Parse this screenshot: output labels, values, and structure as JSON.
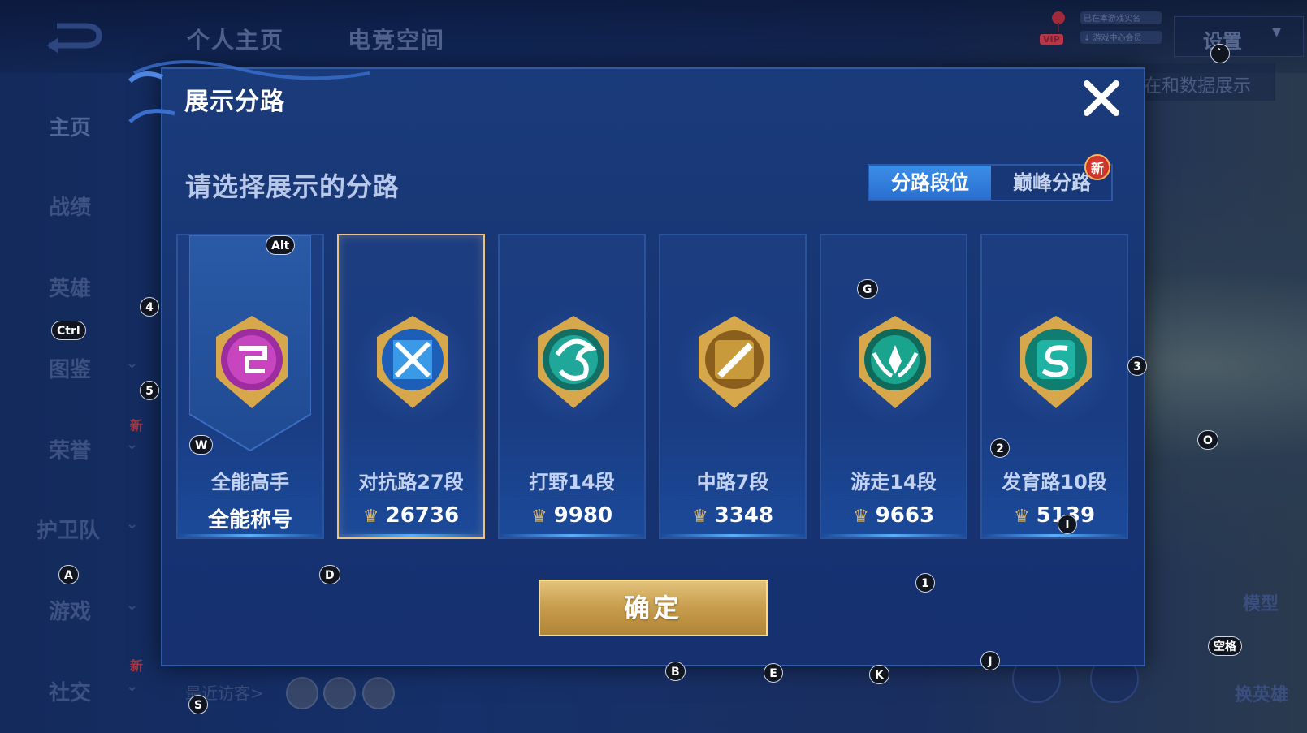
{
  "header": {
    "tabs": [
      "个人主页",
      "电竞空间"
    ],
    "settings_label": "设置",
    "vip_label": "VIP",
    "vip_lines": [
      "已在本游戏实名",
      "↓ 游戏中心会员"
    ],
    "data_show_label": "在和数据展示"
  },
  "sidebar": {
    "items": [
      {
        "label": "主页",
        "has_arrow": false
      },
      {
        "label": "战绩",
        "has_arrow": false
      },
      {
        "label": "英雄",
        "has_arrow": false
      },
      {
        "label": "图鉴",
        "has_arrow": true
      },
      {
        "label": "荣誉",
        "has_arrow": true
      },
      {
        "label": "护卫队",
        "has_arrow": true
      },
      {
        "label": "游戏",
        "has_arrow": true
      },
      {
        "label": "社交",
        "has_arrow": true
      }
    ],
    "new_badge": "新"
  },
  "visitors": {
    "label": "最近访客>"
  },
  "right_panel": {
    "model_label": "模型",
    "change_hero_label": "换英雄"
  },
  "dialog": {
    "title": "展示分路",
    "subtitle": "请选择展示的分路",
    "tabs": {
      "active": "分路段位",
      "inactive": "巅峰分路",
      "new_badge": "新"
    },
    "confirm_label": "确定",
    "cards": [
      {
        "name": "全能高手",
        "score": "全能称号",
        "selected": false,
        "emblem": "all-round-emblem-icon",
        "color": "#c43fb0"
      },
      {
        "name": "对抗路27段",
        "score": "26736",
        "selected": true,
        "emblem": "clash-lane-emblem-icon",
        "color": "#3a9ae8"
      },
      {
        "name": "打野14段",
        "score": "9980",
        "selected": false,
        "emblem": "jungle-emblem-icon",
        "color": "#1fa79a"
      },
      {
        "name": "中路7段",
        "score": "3348",
        "selected": false,
        "emblem": "mid-lane-emblem-icon",
        "color": "#c99a3c"
      },
      {
        "name": "游走14段",
        "score": "9663",
        "selected": false,
        "emblem": "roam-emblem-icon",
        "color": "#1aa38d"
      },
      {
        "name": "发育路10段",
        "score": "5139",
        "selected": false,
        "emblem": "farm-lane-emblem-icon",
        "color": "#20b2a2"
      }
    ]
  },
  "key_hints": [
    {
      "key": "`"
    },
    {
      "key": "Alt"
    },
    {
      "key": "4"
    },
    {
      "key": "Ctrl"
    },
    {
      "key": "5"
    },
    {
      "key": "W"
    },
    {
      "key": "G"
    },
    {
      "key": "3"
    },
    {
      "key": "O"
    },
    {
      "key": "2"
    },
    {
      "key": "I"
    },
    {
      "key": "A"
    },
    {
      "key": "D"
    },
    {
      "key": "1"
    },
    {
      "key": "B"
    },
    {
      "key": "E"
    },
    {
      "key": "K"
    },
    {
      "key": "J"
    },
    {
      "key": "空格"
    },
    {
      "key": "S"
    }
  ]
}
